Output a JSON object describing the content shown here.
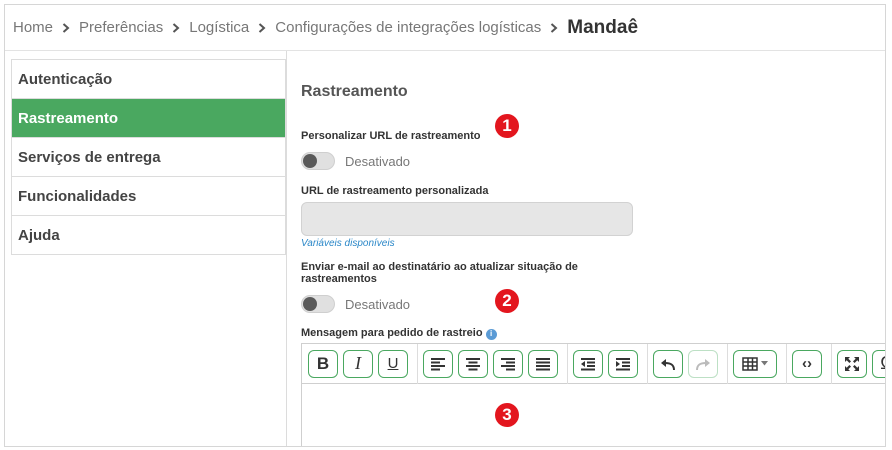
{
  "breadcrumb": {
    "items": [
      "Home",
      "Preferências",
      "Logística",
      "Configurações de integrações logísticas"
    ],
    "current": "Mandaê"
  },
  "sidebar": {
    "items": [
      {
        "label": "Autenticação",
        "active": false
      },
      {
        "label": "Rastreamento",
        "active": true
      },
      {
        "label": "Serviços de entrega",
        "active": false
      },
      {
        "label": "Funcionalidades",
        "active": false
      },
      {
        "label": "Ajuda",
        "active": false
      }
    ]
  },
  "main": {
    "section_title": "Rastreamento",
    "custom_url_label": "Personalizar URL de rastreamento",
    "custom_url_toggle": {
      "state": "Desativado",
      "on": false
    },
    "url_field_label": "URL de rastreamento personalizada",
    "url_field_value": "",
    "variables_link": "Variáveis disponíveis",
    "email_label_line1": "Enviar e-mail ao destinatário ao atualizar situação de",
    "email_label_line2": "rastreamentos",
    "email_toggle": {
      "state": "Desativado",
      "on": false
    },
    "message_label": "Mensagem para pedido de rastreio",
    "info_glyph": "i",
    "editor_content": ""
  },
  "toolbar": {
    "bold": "B",
    "italic": "I",
    "underline": "U",
    "special_char": "Ω",
    "code": "‹›"
  },
  "annotations": [
    "1",
    "2",
    "3"
  ],
  "colors": {
    "accent": "#4aa860",
    "annotation": "#e3161e",
    "link": "#2a87c8"
  }
}
